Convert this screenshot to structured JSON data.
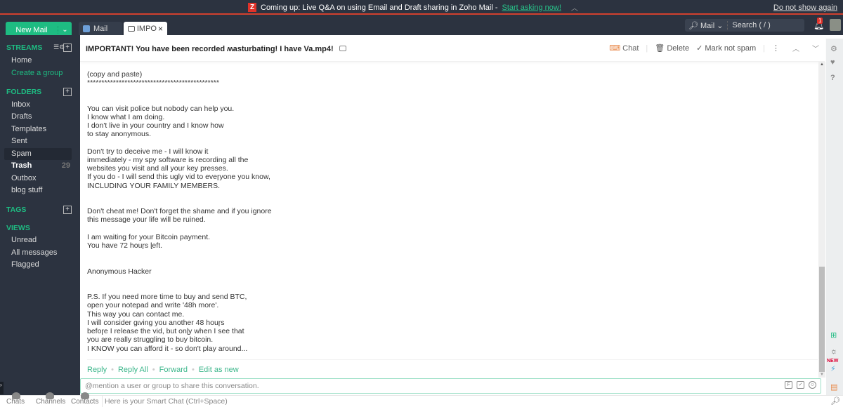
{
  "banner": {
    "logo": "Z",
    "text": "Coming up: Live Q&A on using Email and Draft sharing in Zoho Mail - ",
    "link": "Start asking now!",
    "collapse_icon": "chevron-up-icon",
    "dismiss": "Do not show again"
  },
  "topbar": {
    "new_mail": "New Mail",
    "tabs": [
      {
        "label": "Mail",
        "icon": "mail-app-icon"
      },
      {
        "label": "IMPO",
        "icon": "envelope-open-icon",
        "close": "×"
      }
    ],
    "search": {
      "scope": "Mail",
      "placeholder": "Search ( / )"
    },
    "notifications": {
      "count": "1"
    }
  },
  "sidebar": {
    "streams": {
      "title": "STREAMS",
      "items": [
        {
          "label": "Home"
        },
        {
          "label": "Create a group"
        }
      ]
    },
    "folders": {
      "title": "FOLDERS",
      "items": [
        {
          "label": "Inbox"
        },
        {
          "label": "Drafts"
        },
        {
          "label": "Templates"
        },
        {
          "label": "Sent"
        },
        {
          "label": "Spam",
          "active": true
        },
        {
          "label": "Trash",
          "count": "29"
        },
        {
          "label": "Outbox"
        },
        {
          "label": "blog stuff"
        }
      ]
    },
    "tags": {
      "title": "TAGS"
    },
    "views": {
      "title": "VIEWS",
      "items": [
        {
          "label": "Unread"
        },
        {
          "label": "All messages"
        },
        {
          "label": "Flagged"
        }
      ]
    }
  },
  "message": {
    "subject": "IMPORTANT! You have been recorded ʍasturbating! I have Va.mp4!",
    "actions": {
      "chat": "Chat",
      "delete": "Delete",
      "mark_not_spam": "Mark not spam"
    },
    "body": "(copy and paste)\n**********************************************\n\n\nYou can visit police but nobody can help you.\nI know what I am doing.\nI don't live in your country and I know how\nto stay anonymous.\n\nDon't try to deceive me - I will know it\nimmediately - my spy software is recording all the\nwebsites you visit and all your key presses.\nIf you do - I will send this ugly vid to eveɼyone you know,\nINCLUDING YOUR FAMILY MEMBERS.\n\n\nDon't cheat me! Don't forget the shame and if you ignore\nthis message your life will be ruined.\n\nI am waiting for your Bitcoin payment.\nYou have 72 houɼs ɭeft.\n\n\nAnonymous Hacker\n\n\nP.S. If you need more time to buy and send BTC,\nopen your notepad and write '48h more'.\nThis way you can contact me.\nI will consider gɩving you another 48 houɼs\nbefoɼe I release the vid, but onɭy when I see that\nyou are really struggling to buy bitcoin.\nI KNOW you can afford it - so don't play around...",
    "reply_actions": [
      "Reply",
      "Reply All",
      "Forward",
      "Edit as new"
    ]
  },
  "mention_input": {
    "placeholder": "@mention a user or group to share this conversation."
  },
  "bottombar": {
    "items": [
      "Chats",
      "Channels",
      "Contacts"
    ],
    "smart_chat_placeholder": "Here is your Smart Chat (Ctrl+Space)"
  }
}
